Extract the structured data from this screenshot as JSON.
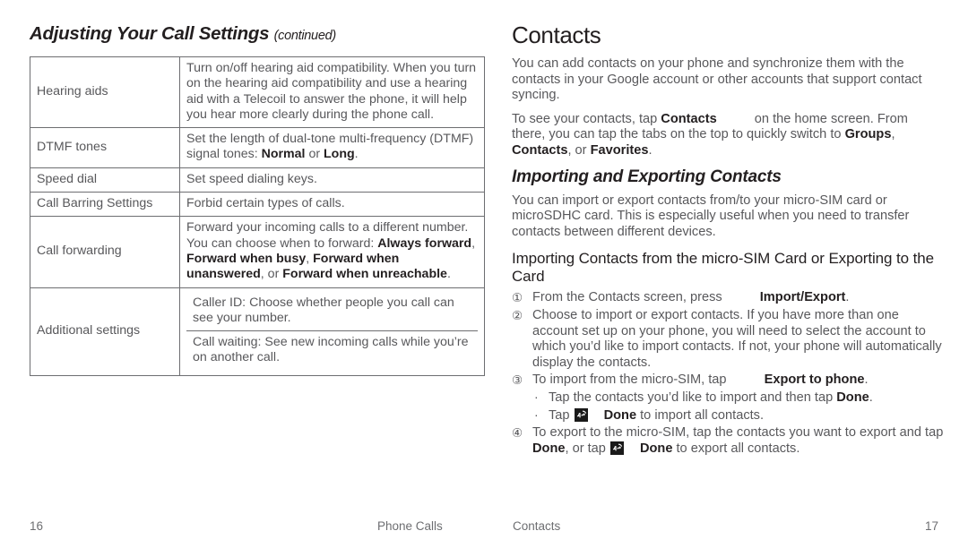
{
  "left_page": {
    "chapter_title": "Adjusting Your Call Settings",
    "chapter_title_continued": "(continued)",
    "table": {
      "rows": [
        {
          "name": "Hearing aids",
          "desc_plain": "Turn on/off hearing aid compatibility. When you turn on the hearing aid compatibility and use a hearing aid with a Telecoil to answer the phone, it will help you hear more clearly during the phone call."
        },
        {
          "name": "DTMF tones",
          "desc_pre": "Set the length of dual-tone multi-frequency (DTMF) signal tones: ",
          "desc_b1": "Normal",
          "desc_mid": " or ",
          "desc_b2": "Long",
          "desc_post": "."
        },
        {
          "name": "Speed dial",
          "desc_plain": "Set speed dialing keys."
        },
        {
          "name": "Call Barring Settings",
          "desc_plain": "Forbid certain types of calls."
        },
        {
          "name": "Call forwarding",
          "desc_pre": "Forward your incoming calls to a different number. You can choose when to forward: ",
          "desc_b1": "Always forward",
          "desc_s1": ", ",
          "desc_b2": "Forward when busy",
          "desc_s2": ", ",
          "desc_b3": "Forward when unanswered",
          "desc_s3": ", or ",
          "desc_b4": "Forward when unreachable",
          "desc_post": "."
        },
        {
          "name": "Additional settings",
          "sub_rows": [
            "Caller ID: Choose whether people you call can see your number.",
            "Call waiting: See new incoming calls while you’re on another call."
          ]
        }
      ]
    }
  },
  "right_page": {
    "section_title": "Contacts",
    "intro_paragraph": "You can add contacts on your phone and synchronize them with the contacts in your Google account or other accounts that support contact syncing.",
    "see_contacts": {
      "pre": "To see your contacts, tap ",
      "bold1": "Contacts",
      "mid": " on the home screen. From there, you can tap the tabs on the top to quickly switch to ",
      "bold2": "Groups",
      "sep1": ", ",
      "bold3": "Contacts",
      "sep2": ", or ",
      "bold4": "Favorites",
      "post": "."
    },
    "sub_title": "Importing and Exporting Contacts",
    "import_export_paragraph": "You can import or export contacts from/to your micro-SIM card or microSDHC card. This is especially useful when you need to transfer contacts between different devices.",
    "sub_sub_title": "Importing Contacts from the micro-SIM Card or Exporting to the Card",
    "steps": [
      {
        "num": "①",
        "pre": "From the Contacts screen, press ",
        "icon": "menu-key-icon",
        "bold": "Import/Export",
        "post": "."
      },
      {
        "num": "②",
        "pre": "Choose to import or export contacts. If you have more than one account set up on your phone, you will need to select the account to which you’d like to import contacts. If not, your phone will automatically display the contacts.",
        "bold": "",
        "post": ""
      },
      {
        "num": "③",
        "pre": "To import from the micro-SIM, tap ",
        "icon": "menu-key-icon",
        "bold": "Export to phone",
        "post": ".",
        "bullets": [
          {
            "dot": "·",
            "pre": "Tap the contacts you’d like to import and then tap ",
            "bold": "Done",
            "post": "."
          },
          {
            "dot": "·",
            "pre": "Tap ",
            "icon": "menu-key-icon",
            "bold": "Done",
            "post": " to import all contacts."
          }
        ]
      },
      {
        "num": "④",
        "pre": "To export to the micro-SIM, tap the contacts you want to export and tap ",
        "bold": "Done",
        "mid": ", or tap ",
        "icon": "menu-key-icon",
        "bold2": "Done",
        "post": " to export all contacts."
      }
    ]
  },
  "footer": {
    "page_left": "16",
    "running_head_left": "Phone Calls",
    "running_head_right": "Contacts",
    "page_right": "17"
  },
  "colors": {
    "body_text": "#58585b",
    "heading_text": "#231f20",
    "table_border": "#6d6e71",
    "background": "#ffffff"
  }
}
